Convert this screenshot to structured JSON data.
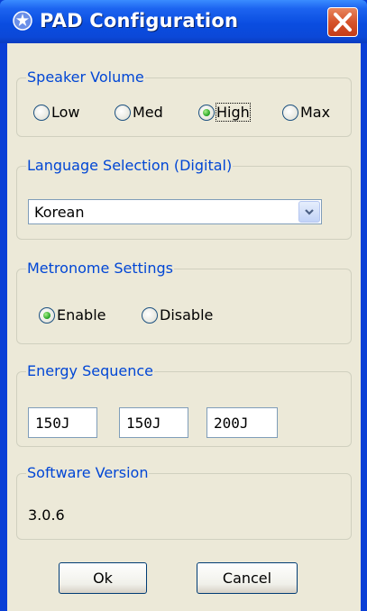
{
  "window": {
    "title": "PAD Configuration",
    "app_icon": "gear-star-icon",
    "close_icon": "close-icon"
  },
  "speaker_volume": {
    "label": "Speaker Volume",
    "options": [
      "Low",
      "Med",
      "High",
      "Max"
    ],
    "selected": "High"
  },
  "language": {
    "label": "Language Selection (Digital)",
    "selected": "Korean",
    "dropdown_icon": "chevron-down-icon"
  },
  "metronome": {
    "label": "Metronome Settings",
    "options": [
      "Enable",
      "Disable"
    ],
    "selected": "Enable"
  },
  "energy": {
    "label": "Energy Sequence",
    "values": [
      "150J",
      "150J",
      "200J"
    ]
  },
  "software": {
    "label": "Software Version",
    "value": "3.0.6"
  },
  "buttons": {
    "ok": "Ok",
    "cancel": "Cancel"
  },
  "colors": {
    "title_bar": "#0a4de0",
    "group_label": "#0046d5",
    "close_button": "#d6532b",
    "radio_selected": "#21a121"
  }
}
